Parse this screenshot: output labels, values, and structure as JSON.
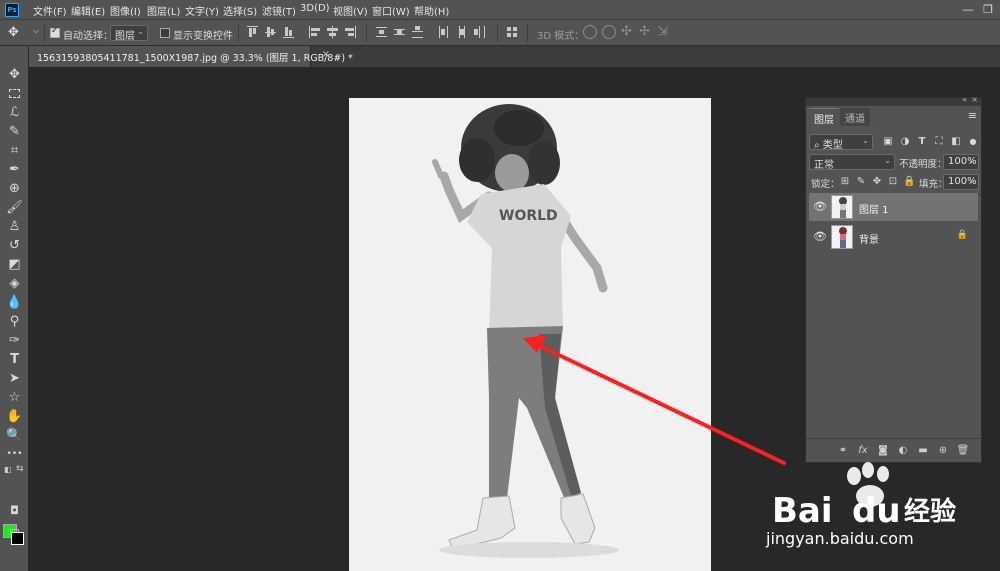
{
  "app": {
    "logo": "Ps"
  },
  "menubar": {
    "items": [
      {
        "label": "文件(F)"
      },
      {
        "label": "编辑(E)"
      },
      {
        "label": "图像(I)"
      },
      {
        "label": "图层(L)"
      },
      {
        "label": "文字(Y)"
      },
      {
        "label": "选择(S)"
      },
      {
        "label": "滤镜(T)"
      },
      {
        "label": "3D(D)"
      },
      {
        "label": "视图(V)"
      },
      {
        "label": "窗口(W)"
      },
      {
        "label": "帮助(H)"
      }
    ],
    "window_controls": {
      "minimize": "—",
      "restore": "❐"
    }
  },
  "options": {
    "auto_select_label": "自动选择：",
    "auto_select_checked": true,
    "auto_select_target": "图层",
    "show_transform_label": "显示变换控件",
    "show_transform_checked": false,
    "mode_3d_label": "3D 模式："
  },
  "document": {
    "tab_title": "15631593805411781_1500X1987.jpg @ 33.3% (图层 1, RGB/8#) *",
    "tab_close": "×"
  },
  "tools": [
    {
      "icon": "move-icon"
    },
    {
      "icon": "marquee-icon"
    },
    {
      "icon": "lasso-icon"
    },
    {
      "icon": "quick-select-icon"
    },
    {
      "icon": "crop-icon"
    },
    {
      "icon": "eyedropper-icon"
    },
    {
      "icon": "healing-brush-icon"
    },
    {
      "icon": "brush-icon"
    },
    {
      "icon": "clone-stamp-icon"
    },
    {
      "icon": "history-brush-icon"
    },
    {
      "icon": "eraser-icon"
    },
    {
      "icon": "paint-bucket-icon"
    },
    {
      "icon": "blur-icon"
    },
    {
      "icon": "dodge-icon"
    },
    {
      "icon": "pen-icon"
    },
    {
      "icon": "type-icon",
      "glyph": "T"
    },
    {
      "icon": "path-select-icon"
    },
    {
      "icon": "shape-icon"
    },
    {
      "icon": "hand-icon"
    },
    {
      "icon": "zoom-icon"
    },
    {
      "icon": "more-tools-icon",
      "glyph": "•••"
    }
  ],
  "colors": {
    "foreground": "#22e622",
    "background": "#000000",
    "accent_arrow": "#ff1f1f"
  },
  "layers_panel": {
    "tabs": [
      {
        "label": "图层"
      },
      {
        "label": "通道"
      }
    ],
    "filter_kind": "类型",
    "blend_mode": "正常",
    "opacity_label": "不透明度：",
    "opacity_value": "100%",
    "lock_label": "锁定：",
    "fill_label": "填充：",
    "fill_value": "100%",
    "layers": [
      {
        "name": "图层 1",
        "visible": true,
        "selected": true
      },
      {
        "name": "背景",
        "visible": true,
        "locked": true,
        "selected": false
      }
    ]
  },
  "watermark": {
    "brand": "Bai",
    "brand2": "du",
    "product": "经验",
    "url": "jingyan.baidu.com"
  }
}
